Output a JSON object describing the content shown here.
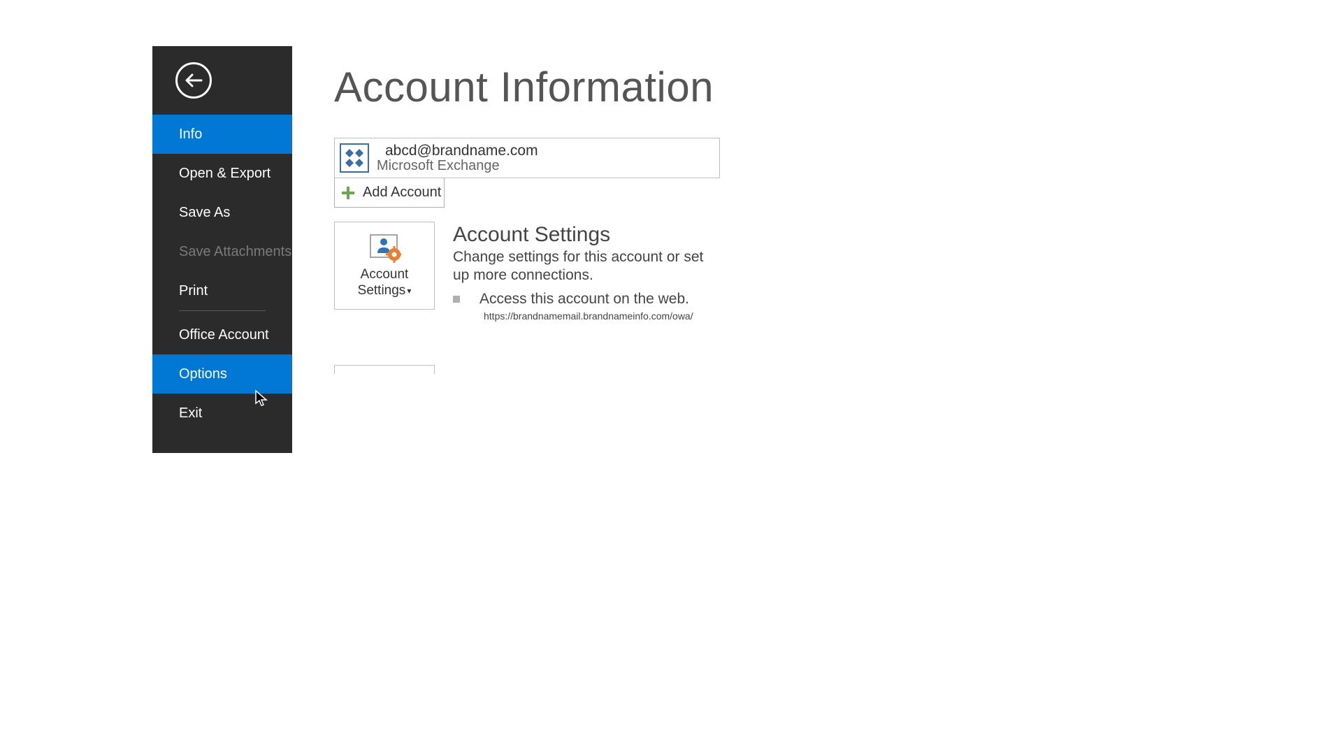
{
  "sidebar": {
    "items": [
      {
        "label": "Info",
        "state": "selected"
      },
      {
        "label": "Open & Export",
        "state": "normal"
      },
      {
        "label": "Save As",
        "state": "normal"
      },
      {
        "label": "Save Attachments",
        "state": "disabled"
      },
      {
        "label": "Print",
        "state": "normal"
      },
      {
        "label": "Office Account",
        "state": "normal"
      },
      {
        "label": "Options",
        "state": "hovered"
      },
      {
        "label": "Exit",
        "state": "normal"
      }
    ]
  },
  "main": {
    "title": "Account Information",
    "account": {
      "email": "abcd@brandname.com",
      "type": "Microsoft Exchange"
    },
    "add_account_label": "Add Account",
    "settings": {
      "tile_label_line1": "Account",
      "tile_label_line2": "Settings",
      "heading": "Account Settings",
      "description": "Change settings for this account or set up more connections.",
      "bullet_text": "Access this account on the web.",
      "url": "https://brandnamemail.brandnameinfo.com/owa/"
    }
  }
}
